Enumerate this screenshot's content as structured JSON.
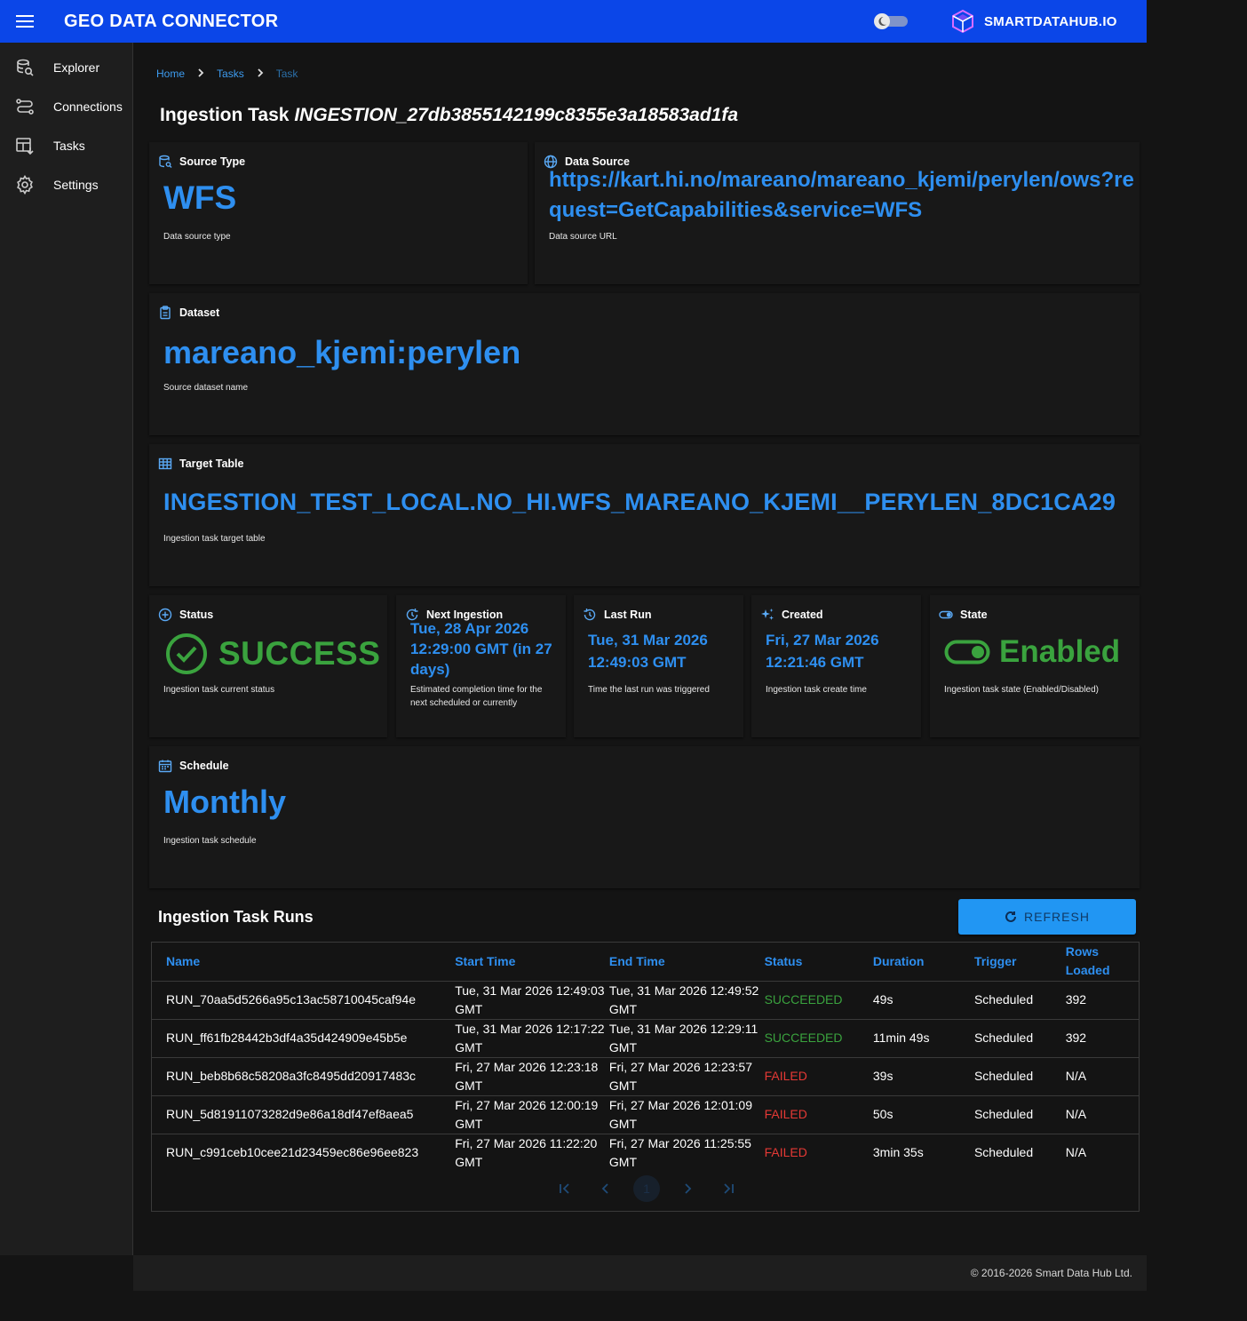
{
  "header": {
    "title": "GEO DATA CONNECTOR",
    "brand": "SMARTDATAHUB.IO"
  },
  "sidebar": {
    "items": [
      {
        "label": "Explorer",
        "icon": "explorer-icon"
      },
      {
        "label": "Connections",
        "icon": "connections-icon"
      },
      {
        "label": "Tasks",
        "icon": "tasks-icon"
      },
      {
        "label": "Settings",
        "icon": "gear-icon"
      }
    ]
  },
  "breadcrumb": {
    "home": "Home",
    "tasks": "Tasks",
    "current": "Task"
  },
  "page": {
    "title_prefix": "Ingestion Task",
    "task_id": "INGESTION_27db3855142199c8355e3a18583ad1fa"
  },
  "cards": {
    "source_type": {
      "label": "Source Type",
      "value": "WFS",
      "caption": "Data source type"
    },
    "data_source": {
      "label": "Data Source",
      "value": "https://kart.hi.no/mareano/mareano_kjemi/perylen/ows?request=GetCapabilities&service=WFS",
      "caption": "Data source URL"
    },
    "dataset": {
      "label": "Dataset",
      "value": "mareano_kjemi:perylen",
      "caption": "Source dataset name"
    },
    "target_table": {
      "label": "Target Table",
      "value": "INGESTION_TEST_LOCAL.NO_HI.WFS_MAREANO_KJEMI__PERYLEN_8DC1CA29",
      "caption": "Ingestion task target table"
    },
    "status": {
      "label": "Status",
      "value": "SUCCESS",
      "caption": "Ingestion task current status"
    },
    "next_ingestion": {
      "label": "Next Ingestion",
      "value": "Tue, 28 Apr 2026 12:29:00 GMT (in 27 days)",
      "caption": "Estimated completion time for the next scheduled or currently"
    },
    "last_run": {
      "label": "Last Run",
      "value": "Tue, 31 Mar 2026 12:49:03 GMT",
      "caption": "Time the last run was triggered"
    },
    "created": {
      "label": "Created",
      "value": "Fri, 27 Mar 2026 12:21:46 GMT",
      "caption": "Ingestion task create time"
    },
    "state": {
      "label": "State",
      "value": "Enabled",
      "caption": "Ingestion task state (Enabled/Disabled)"
    },
    "schedule": {
      "label": "Schedule",
      "value": "Monthly",
      "caption": "Ingestion task schedule"
    }
  },
  "runs": {
    "title": "Ingestion Task Runs",
    "refresh_label": "REFRESH",
    "columns": [
      "Name",
      "Start Time",
      "End Time",
      "Status",
      "Duration",
      "Trigger",
      "Rows Loaded"
    ],
    "rows": [
      {
        "name": "RUN_70aa5d5266a95c13ac58710045caf94e",
        "start": "Tue, 31 Mar 2026 12:49:03 GMT",
        "end": "Tue, 31 Mar 2026 12:49:52 GMT",
        "status": "SUCCEEDED",
        "duration": "49s",
        "trigger": "Scheduled",
        "rows": "392"
      },
      {
        "name": "RUN_ff61fb28442b3df4a35d424909e45b5e",
        "start": "Tue, 31 Mar 2026 12:17:22 GMT",
        "end": "Tue, 31 Mar 2026 12:29:11 GMT",
        "status": "SUCCEEDED",
        "duration": "11min 49s",
        "trigger": "Scheduled",
        "rows": "392"
      },
      {
        "name": "RUN_beb8b68c58208a3fc8495dd20917483c",
        "start": "Fri, 27 Mar 2026 12:23:18 GMT",
        "end": "Fri, 27 Mar 2026 12:23:57 GMT",
        "status": "FAILED",
        "duration": "39s",
        "trigger": "Scheduled",
        "rows": "N/A"
      },
      {
        "name": "RUN_5d81911073282d9e86a18df47ef8aea5",
        "start": "Fri, 27 Mar 2026 12:00:19 GMT",
        "end": "Fri, 27 Mar 2026 12:01:09 GMT",
        "status": "FAILED",
        "duration": "50s",
        "trigger": "Scheduled",
        "rows": "N/A"
      },
      {
        "name": "RUN_c991ceb10cee21d23459ec86e96ee823",
        "start": "Fri, 27 Mar 2026 11:22:20 GMT",
        "end": "Fri, 27 Mar 2026 11:25:55 GMT",
        "status": "FAILED",
        "duration": "3min 35s",
        "trigger": "Scheduled",
        "rows": "N/A"
      }
    ],
    "pager": {
      "current_page": "1"
    }
  },
  "footer": {
    "text": "© 2016-2026 Smart Data Hub Ltd."
  },
  "colors": {
    "appbar": "#0b46e8",
    "accent": "#2e8ff0",
    "success": "#3aa33e",
    "failed": "#e53935"
  }
}
